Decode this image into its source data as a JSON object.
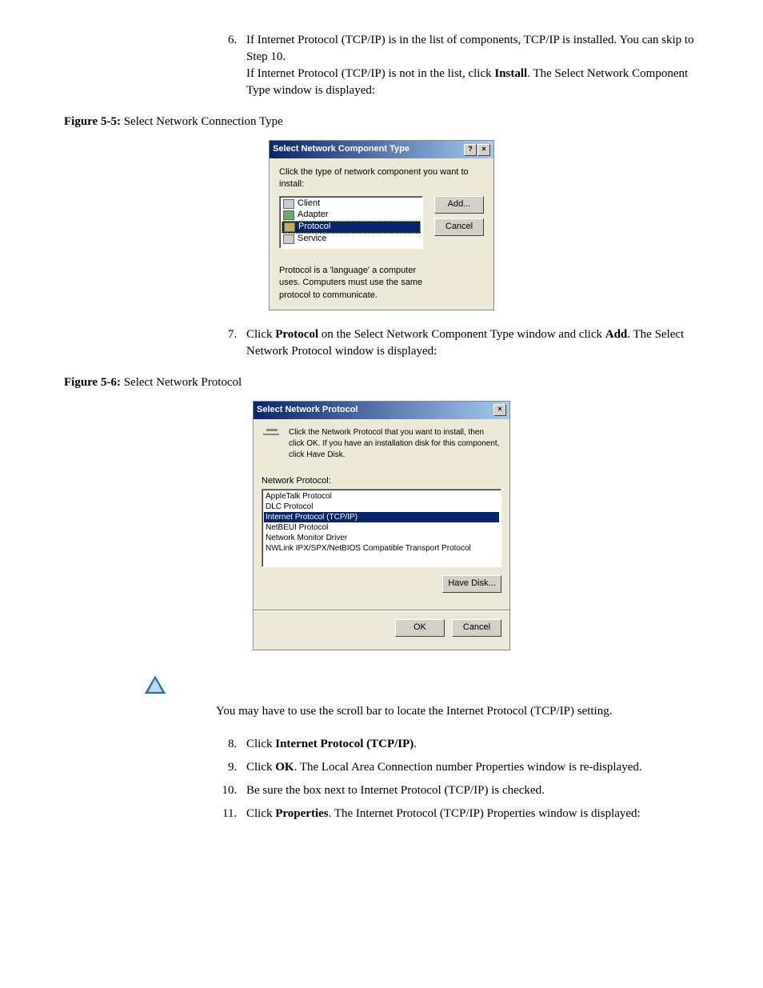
{
  "steps_a": [
    {
      "num": "6.",
      "parts": [
        {
          "t": "If Internet Protocol (TCP/IP) is in the list of components, TCP/IP is installed. You can skip to Step 10."
        },
        {
          "t_before": "If Internet Protocol (TCP/IP) is not in the list, click ",
          "bold": "Install",
          "t_after": ". The Select Network Component Type window is displayed:"
        }
      ]
    }
  ],
  "figure_5_5": {
    "label": "Figure 5-5:",
    "caption": "Select Network Connection Type",
    "dialog": {
      "title": "Select Network Component Type",
      "help_btn": "?",
      "close_btn": "×",
      "instruction": "Click the type of network component you want to install:",
      "items": [
        "Client",
        "Adapter",
        "Protocol",
        "Service"
      ],
      "selected_index": 2,
      "add_btn": "Add...",
      "cancel_btn": "Cancel",
      "description": "Protocol is a 'language' a computer uses. Computers must use the same protocol to communicate."
    }
  },
  "steps_b": [
    {
      "num": "7.",
      "t_before": "Click  ",
      "bold1": "Protocol",
      "t_mid": " on the Select Network Component Type window and click ",
      "bold2": "Add",
      "t_after": ". The Select Network Protocol window is displayed:"
    }
  ],
  "figure_5_6": {
    "label": "Figure 5-6:",
    "caption": "Select Network Protocol",
    "dialog": {
      "title": "Select Network Protocol",
      "close_btn": "×",
      "instruction": "Click the Network Protocol that you want to install, then click OK. If you have an installation disk for this component, click Have Disk.",
      "list_label": "Network Protocol:",
      "items": [
        "AppleTalk Protocol",
        "DLC Protocol",
        "Internet Protocol (TCP/IP)",
        "NetBEUI Protocol",
        "Network Monitor Driver",
        "NWLink IPX/SPX/NetBIOS Compatible Transport Protocol"
      ],
      "selected_index": 2,
      "have_disk_btn": "Have Disk...",
      "ok_btn": "OK",
      "cancel_btn": "Cancel"
    }
  },
  "note": "You may have to use the scroll bar to locate the Internet Protocol (TCP/IP) setting.",
  "steps_c": [
    {
      "num": "8.",
      "t_before": "Click ",
      "bold": "Internet Protocol (TCP/IP)",
      "t_after": "."
    },
    {
      "num": "9.",
      "t_before": "Click ",
      "bold": "OK",
      "t_after": ". The Local Area Connection number Properties window is re-displayed."
    },
    {
      "num": "10.",
      "plain": "Be sure the box next to Internet Protocol (TCP/IP) is checked."
    },
    {
      "num": "11.",
      "t_before": "Click ",
      "bold": "Properties",
      "t_after": ". The Internet Protocol (TCP/IP) Properties window is displayed:"
    }
  ]
}
